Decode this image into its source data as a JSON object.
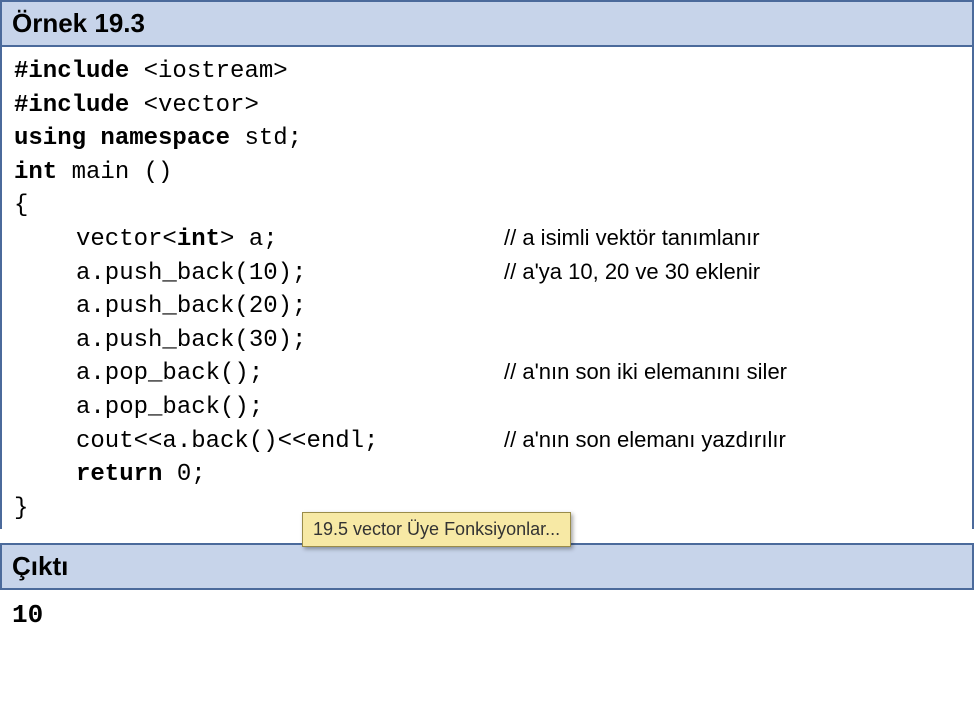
{
  "example": {
    "title": "Örnek 19.3",
    "code": {
      "l1": {
        "kw": "#include",
        "rest": " <iostream>"
      },
      "l2": {
        "kw": "#include",
        "rest": " <vector>"
      },
      "l3": {
        "kw1": "using",
        "mid": " ",
        "kw2": "namespace",
        "rest": " std;"
      },
      "l4": {
        "kw": "int",
        "rest": " main ()"
      },
      "l5": "{",
      "l6": {
        "pre": "vector<",
        "kw": "int",
        "post": "> a;",
        "comment": "// a isimli  vektör tanımlanır"
      },
      "l7": {
        "code": "a.push_back(10);",
        "comment": "// a'ya 10, 20 ve 30 eklenir"
      },
      "l8": {
        "code": "a.push_back(20);"
      },
      "l9": {
        "code": "a.push_back(30);"
      },
      "l10": {
        "code": "a.pop_back();",
        "comment": "// a'nın son iki elemanını siler"
      },
      "l11": {
        "code": "a.pop_back();"
      },
      "l12": {
        "code": "cout<<a.back()<<endl;",
        "comment": "// a'nın son elemanı yazdırılır"
      },
      "l13": {
        "kw": "return",
        "rest": " 0;"
      },
      "l14": "}"
    },
    "tooltip": "19.5 vector Üye Fonksiyonlar...",
    "output_title": "Çıktı",
    "output": "10"
  }
}
